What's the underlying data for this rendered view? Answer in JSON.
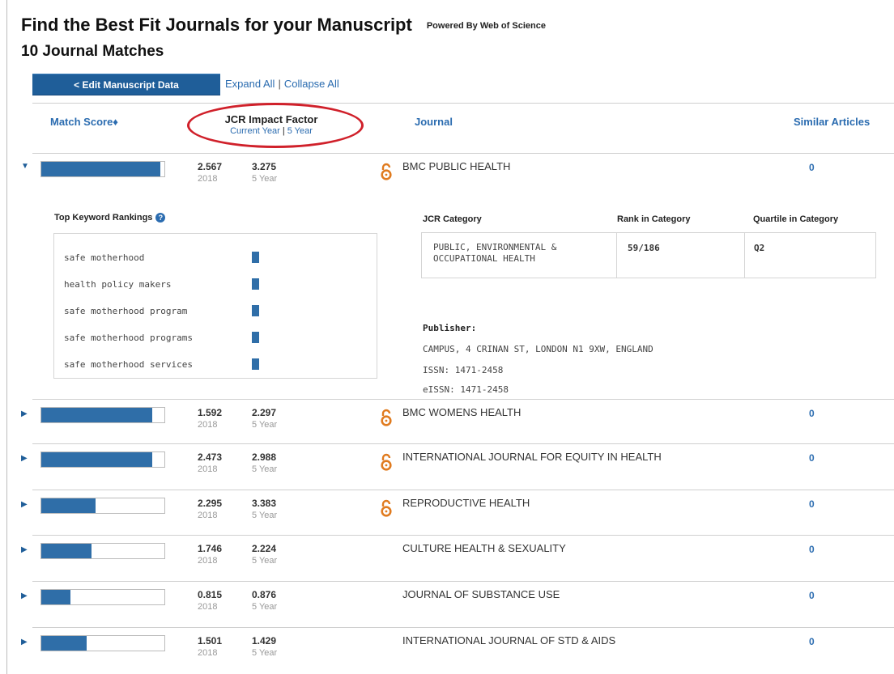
{
  "header": {
    "title": "Find the Best Fit Journals for your Manuscript",
    "powered_by": "Powered By Web of Science",
    "match_count": "10 Journal Matches"
  },
  "toolbar": {
    "edit_label": "< Edit Manuscript Data",
    "expand_all": "Expand All",
    "separator": "|",
    "collapse_all": "Collapse All"
  },
  "columns": {
    "match_score": "Match Score♦",
    "jcr_title": "JCR Impact Factor",
    "jcr_current": "Current Year",
    "jcr_separator": "|",
    "jcr_five": "5 Year",
    "journal": "Journal",
    "similar": "Similar Articles"
  },
  "annotation": {
    "highlight_color": "#d0202a"
  },
  "colors": {
    "accent": "#2b6cb0",
    "button": "#1f5e99",
    "bar": "#2f6ea8"
  },
  "rows": [
    {
      "expanded": true,
      "match_fraction": 0.97,
      "if_current": "2.567",
      "year": "2018",
      "if_five": "3.275",
      "five_label": "5 Year",
      "open_access": true,
      "journal": "BMC PUBLIC HEALTH",
      "similar": "0"
    },
    {
      "expanded": false,
      "match_fraction": 0.9,
      "if_current": "1.592",
      "year": "2018",
      "if_five": "2.297",
      "five_label": "5 Year",
      "open_access": true,
      "journal": "BMC WOMENS HEALTH",
      "similar": "0"
    },
    {
      "expanded": false,
      "match_fraction": 0.9,
      "if_current": "2.473",
      "year": "2018",
      "if_five": "2.988",
      "five_label": "5 Year",
      "open_access": true,
      "journal": "INTERNATIONAL JOURNAL FOR EQUITY IN HEALTH",
      "similar": "0"
    },
    {
      "expanded": false,
      "match_fraction": 0.44,
      "if_current": "2.295",
      "year": "2018",
      "if_five": "3.383",
      "five_label": "5 Year",
      "open_access": true,
      "journal": "REPRODUCTIVE HEALTH",
      "similar": "0"
    },
    {
      "expanded": false,
      "match_fraction": 0.41,
      "if_current": "1.746",
      "year": "2018",
      "if_five": "2.224",
      "five_label": "5 Year",
      "open_access": false,
      "journal": "CULTURE HEALTH & SEXUALITY",
      "similar": "0"
    },
    {
      "expanded": false,
      "match_fraction": 0.24,
      "if_current": "0.815",
      "year": "2018",
      "if_five": "0.876",
      "five_label": "5 Year",
      "open_access": false,
      "journal": "JOURNAL OF SUBSTANCE USE",
      "similar": "0"
    },
    {
      "expanded": false,
      "match_fraction": 0.37,
      "if_current": "1.501",
      "year": "2018",
      "if_five": "1.429",
      "five_label": "5 Year",
      "open_access": false,
      "journal": "INTERNATIONAL JOURNAL OF STD & AIDS",
      "similar": "0"
    }
  ],
  "details": {
    "keyword_title": "Top Keyword Rankings",
    "keywords": [
      "safe motherhood",
      "health policy makers",
      "safe motherhood program",
      "safe motherhood programs",
      "safe motherhood services"
    ],
    "category_header": "JCR Category",
    "rank_header": "Rank in Category",
    "quartile_header": "Quartile in Category",
    "category": "PUBLIC, ENVIRONMENTAL & OCCUPATIONAL HEALTH",
    "rank": "59/186",
    "quartile": "Q2",
    "publisher_label": "Publisher:",
    "publisher_address": "CAMPUS, 4 CRINAN ST, LONDON N1 9XW, ENGLAND",
    "issn": "ISSN: 1471-2458",
    "eissn": "eISSN: 1471-2458"
  }
}
